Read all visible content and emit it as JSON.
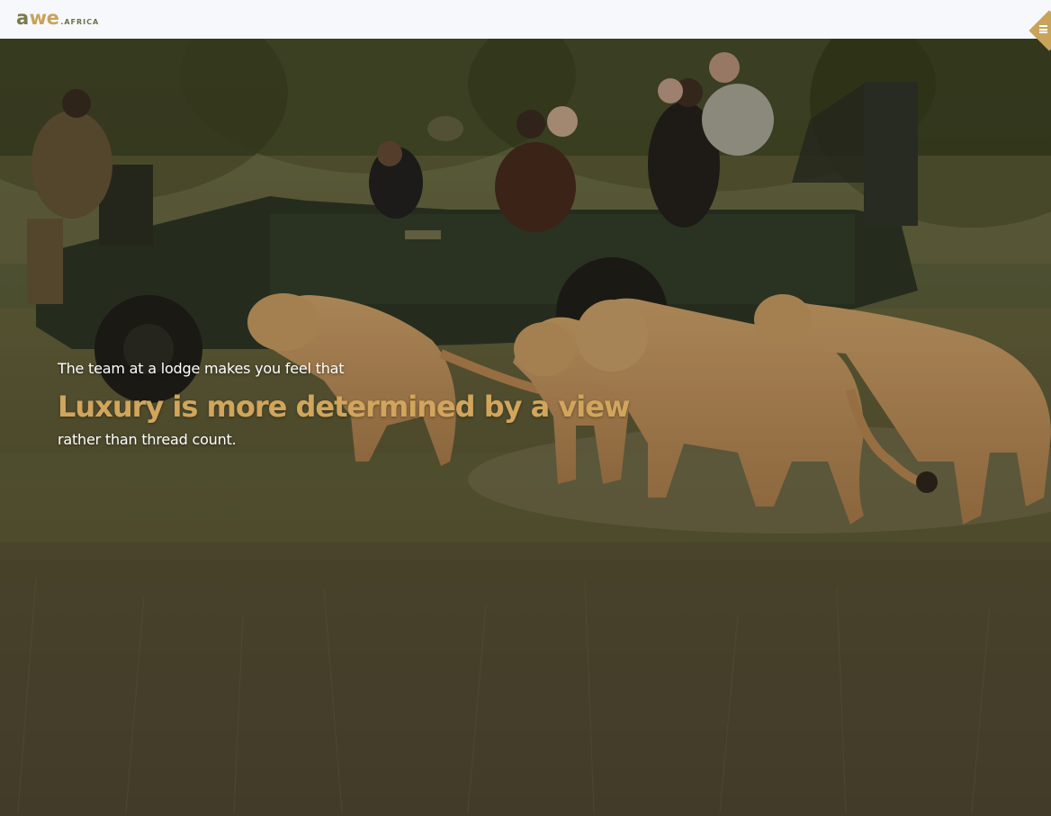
{
  "header": {
    "logo": {
      "part_a": "a",
      "part_we": "we",
      "part_suffix": ".AFRICA"
    },
    "menu_icon": "hamburger-menu-icon"
  },
  "hero": {
    "image": "safari-vehicle-with-lionesses-photo",
    "kicker": "The team at a lodge makes you feel that",
    "headline": "Luxury is more determined by a view",
    "subline": "rather than thread count."
  },
  "colors": {
    "accent": "#c9a35a",
    "logo_dark": "#7a7a4a",
    "header_bg": "#f6f8fb",
    "headline": "#d1a55c"
  }
}
